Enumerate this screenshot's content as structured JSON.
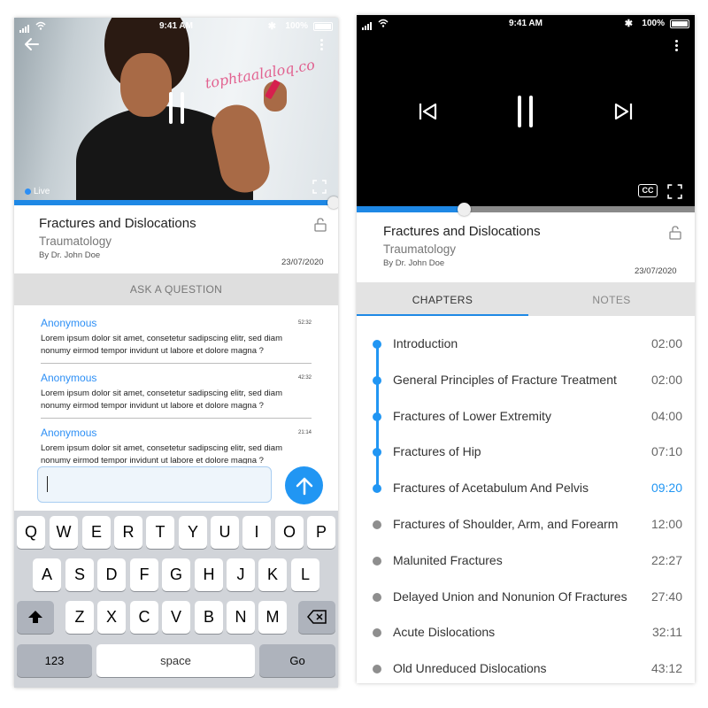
{
  "left_screen": {
    "status_bar": {
      "time": "9:41 AM",
      "battery": "100%"
    },
    "video": {
      "board_text": "tophtaalaloq.co",
      "live_label": "Live"
    },
    "course": {
      "title": "Fractures and Dislocations",
      "subtitle": "Traumatology",
      "author": "By Dr. John Doe",
      "date": "23/07/2020"
    },
    "ask_question_label": "ASK A QUESTION",
    "questions": [
      {
        "name": "Anonymous",
        "time": "52:32",
        "text": "Lorem ipsum dolor sit amet, consetetur sadipscing elitr, sed diam nonumy eirmod tempor invidunt ut labore et dolore magna ?"
      },
      {
        "name": "Anonymous",
        "time": "42:32",
        "text": "Lorem ipsum dolor sit amet, consetetur sadipscing elitr, sed diam nonumy eirmod tempor invidunt ut labore et dolore magna ?"
      },
      {
        "name": "Anonymous",
        "time": "21:14",
        "text": "Lorem ipsum dolor sit amet, consetetur sadipscing elitr, sed diam nonumy eirmod tempor invidunt ut labore et dolore magna ?"
      }
    ],
    "input_value": "",
    "keyboard": {
      "row1": [
        "Q",
        "W",
        "E",
        "R",
        "T",
        "Y",
        "U",
        "I",
        "O",
        "P"
      ],
      "row2": [
        "A",
        "S",
        "D",
        "F",
        "G",
        "H",
        "J",
        "K",
        "L"
      ],
      "row3": [
        "Z",
        "X",
        "C",
        "V",
        "B",
        "N",
        "M"
      ],
      "numbers_key": "123",
      "space_key": "space",
      "go_key": "Go"
    }
  },
  "right_screen": {
    "status_bar": {
      "time": "9:41 AM",
      "battery": "100%"
    },
    "video": {
      "cc_label": "CC",
      "progress_fraction": 0.32
    },
    "course": {
      "title": "Fractures and Dislocations",
      "subtitle": "Traumatology",
      "author": "By Dr. John Doe",
      "date": "23/07/2020"
    },
    "tabs": [
      {
        "label": "CHAPTERS",
        "active": true
      },
      {
        "label": "NOTES",
        "active": false
      }
    ],
    "chapters": [
      {
        "title": "Introduction",
        "time": "02:00",
        "state": "done"
      },
      {
        "title": "General Principles of Fracture Treatment",
        "time": "02:00",
        "state": "done"
      },
      {
        "title": "Fractures of Lower Extremity",
        "time": "04:00",
        "state": "done"
      },
      {
        "title": "Fractures of Hip",
        "time": "07:10",
        "state": "done"
      },
      {
        "title": "Fractures of Acetabulum And Pelvis",
        "time": "09:20",
        "state": "current"
      },
      {
        "title": "Fractures of Shoulder, Arm, and Forearm",
        "time": "12:00",
        "state": "upcoming"
      },
      {
        "title": "Malunited Fractures",
        "time": "22:27",
        "state": "upcoming"
      },
      {
        "title": "Delayed Union and Nonunion Of Fractures",
        "time": "27:40",
        "state": "upcoming"
      },
      {
        "title": "Acute Dislocations",
        "time": "32:11",
        "state": "upcoming"
      },
      {
        "title": "Old Unreduced Dislocations",
        "time": "43:12",
        "state": "upcoming"
      }
    ],
    "colors": {
      "accent": "#2196f3",
      "upcoming_dot": "#8e8e8e"
    }
  }
}
